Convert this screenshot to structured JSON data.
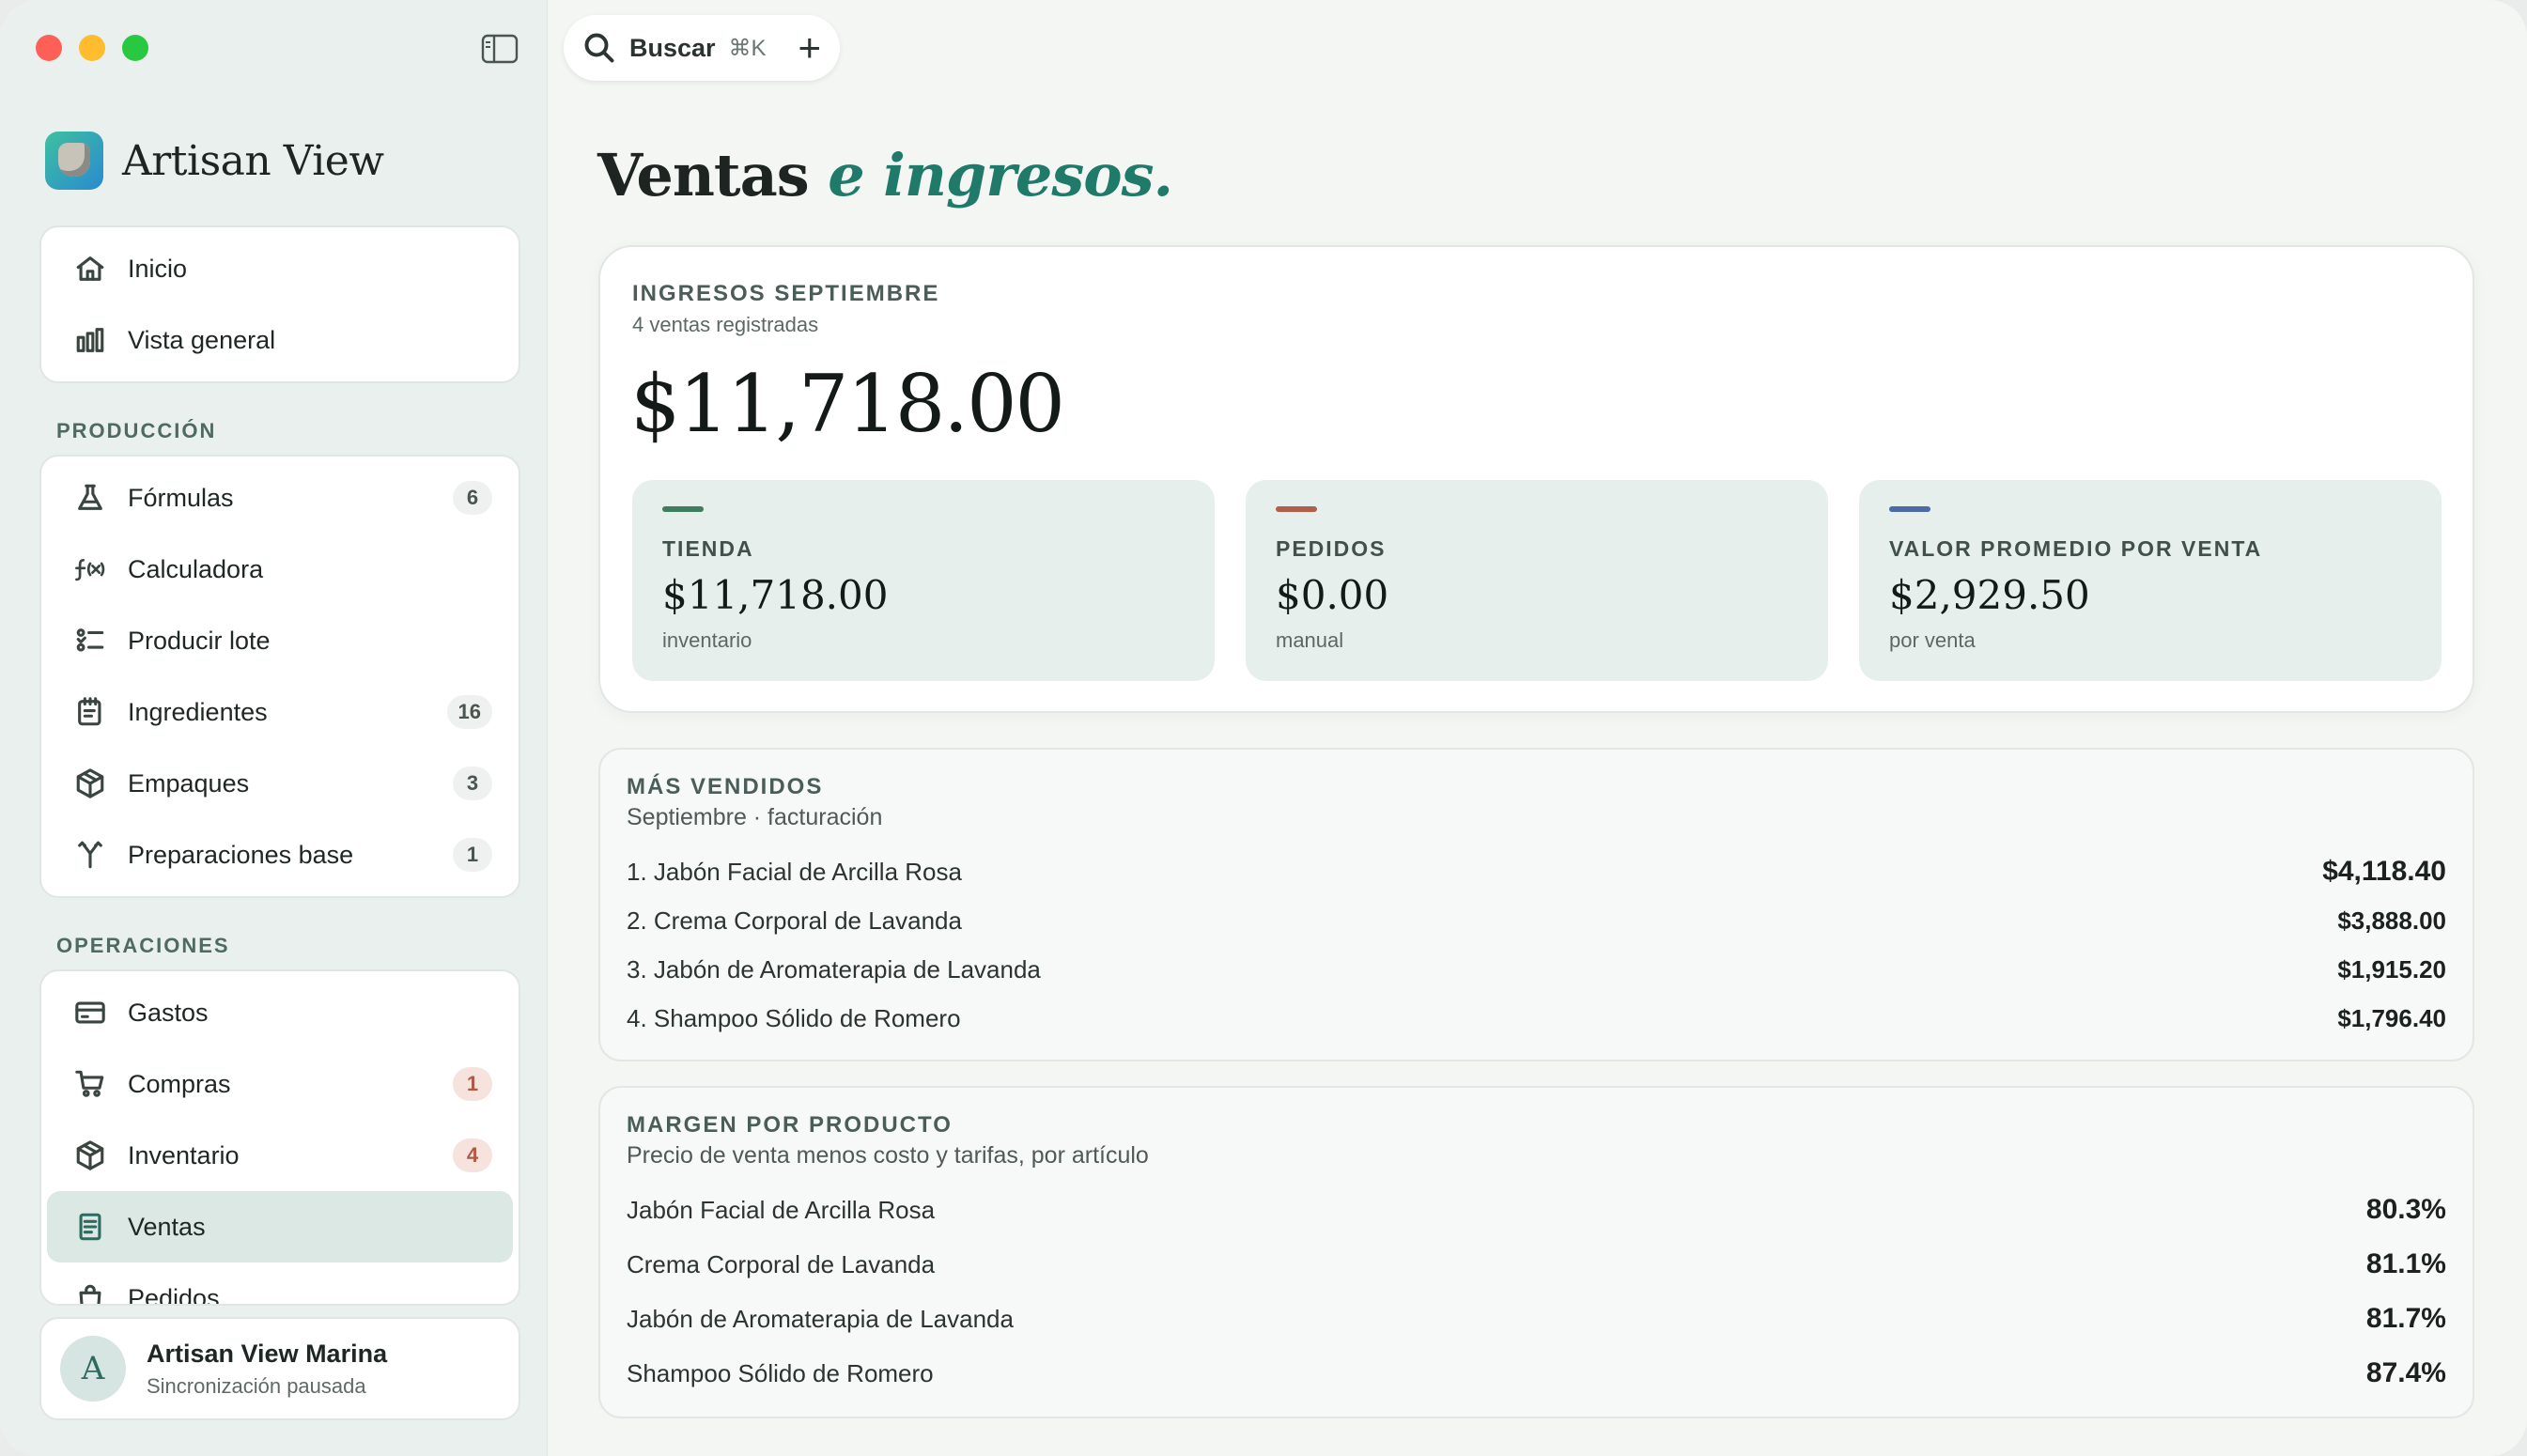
{
  "app": {
    "name": "Artisan View"
  },
  "search": {
    "label": "Buscar",
    "shortcut": "⌘K"
  },
  "sidebar": {
    "top_items": [
      {
        "label": "Inicio",
        "icon": "home-icon"
      },
      {
        "label": "Vista general",
        "icon": "bar-chart-icon"
      }
    ],
    "produccion": {
      "title": "PRODUCCIÓN",
      "items": [
        {
          "label": "Fórmulas",
          "icon": "flask-icon",
          "badge": "6"
        },
        {
          "label": "Calculadora",
          "icon": "function-icon"
        },
        {
          "label": "Producir lote",
          "icon": "list-check-icon"
        },
        {
          "label": "Ingredientes",
          "icon": "notepad-icon",
          "badge": "16"
        },
        {
          "label": "Empaques",
          "icon": "box-icon",
          "badge": "3"
        },
        {
          "label": "Preparaciones base",
          "icon": "merge-icon",
          "badge": "1"
        }
      ]
    },
    "operaciones": {
      "title": "OPERACIONES",
      "items": [
        {
          "label": "Gastos",
          "icon": "credit-card-icon"
        },
        {
          "label": "Compras",
          "icon": "cart-icon",
          "badge": "1"
        },
        {
          "label": "Inventario",
          "icon": "box-icon",
          "badge": "4"
        },
        {
          "label": "Ventas",
          "icon": "receipt-icon",
          "active": true
        },
        {
          "label": "Pedidos",
          "icon": "bag-icon"
        }
      ]
    },
    "account": {
      "initial": "A",
      "name": "Artisan View Marina",
      "status": "Sincronización pausada"
    }
  },
  "page": {
    "title": "Ventas",
    "title_accent": "e ingresos."
  },
  "hero": {
    "eyebrow": "INGRESOS SEPTIEMBRE",
    "subtitle": "4 ventas registradas",
    "amount": "$11,718.00",
    "metrics": [
      {
        "label": "TIENDA",
        "value": "$11,718.00",
        "sub": "inventario",
        "color": "#3f7d5c"
      },
      {
        "label": "PEDIDOS",
        "value": "$0.00",
        "sub": "manual",
        "color": "#b0604a"
      },
      {
        "label": "VALOR PROMEDIO POR VENTA",
        "value": "$2,929.50",
        "sub": "por venta",
        "color": "#4a6aa8"
      }
    ]
  },
  "top_sellers": {
    "eyebrow": "MÁS VENDIDOS",
    "subtitle": "Septiembre · facturación",
    "rows": [
      {
        "name": "1. Jabón Facial de Arcilla Rosa",
        "value": "$4,118.40"
      },
      {
        "name": "2. Crema Corporal de Lavanda",
        "value": "$3,888.00"
      },
      {
        "name": "3. Jabón de Aromaterapia de Lavanda",
        "value": "$1,915.20"
      },
      {
        "name": "4. Shampoo Sólido de Romero",
        "value": "$1,796.40"
      }
    ]
  },
  "margins": {
    "eyebrow": "MARGEN POR PRODUCTO",
    "subtitle": "Precio de venta menos costo y tarifas, por artículo",
    "rows": [
      {
        "name": "Jabón Facial de Arcilla Rosa",
        "value": "80.3%"
      },
      {
        "name": "Crema Corporal de Lavanda",
        "value": "81.1%"
      },
      {
        "name": "Jabón de Aromaterapia de Lavanda",
        "value": "81.7%"
      },
      {
        "name": "Shampoo Sólido de Romero",
        "value": "87.4%"
      }
    ]
  }
}
